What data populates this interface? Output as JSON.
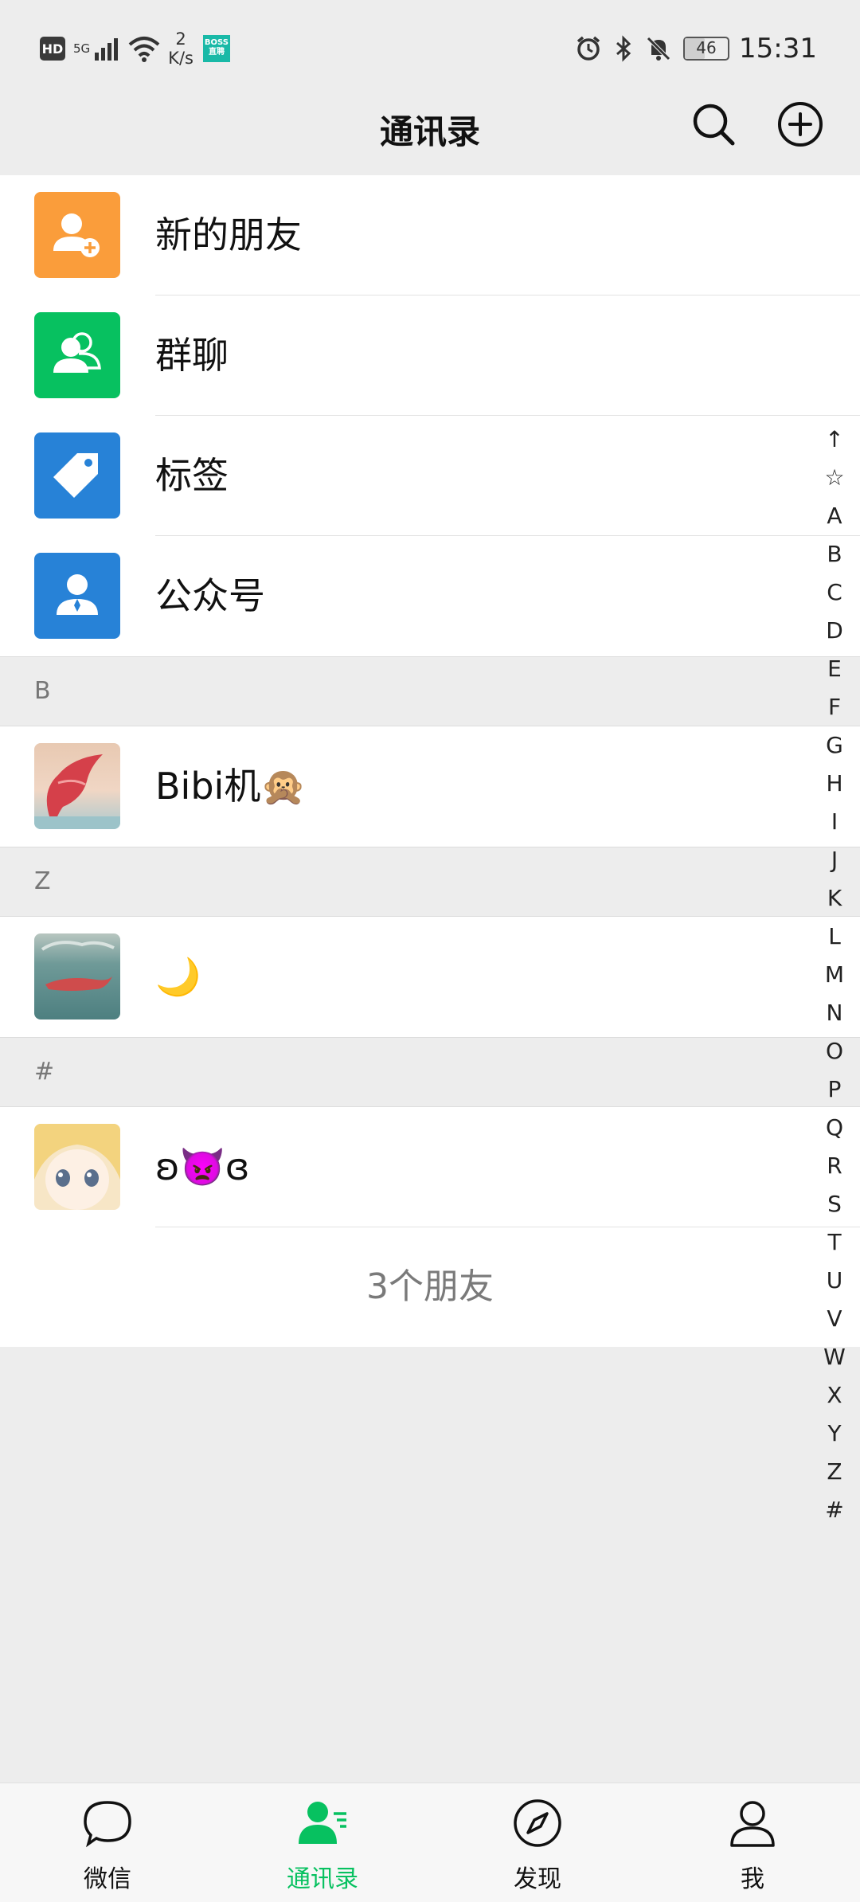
{
  "status_bar": {
    "hd": "HD",
    "network": "5G",
    "speed_value": "2",
    "speed_unit": "K/s",
    "boss_label_1": "BOSS",
    "boss_label_2": "直聘",
    "battery": "46",
    "time": "15:31"
  },
  "header": {
    "title": "通讯录"
  },
  "top_entries": [
    {
      "label": "新的朋友",
      "color": "#fa9d3b"
    },
    {
      "label": "群聊",
      "color": "#07c160"
    },
    {
      "label": "标签",
      "color": "#2782d7"
    },
    {
      "label": "公众号",
      "color": "#2782d7"
    }
  ],
  "sections": [
    {
      "letter": "B",
      "contact": "Bibi机🙊"
    },
    {
      "letter": "Z",
      "contact": "🌙"
    },
    {
      "letter": "#",
      "contact": "ʚ👿ɞ"
    }
  ],
  "footer": {
    "count": "3个朋友"
  },
  "index_letters": [
    "↑",
    "☆",
    "A",
    "B",
    "C",
    "D",
    "E",
    "F",
    "G",
    "H",
    "I",
    "J",
    "K",
    "L",
    "M",
    "N",
    "O",
    "P",
    "Q",
    "R",
    "S",
    "T",
    "U",
    "V",
    "W",
    "X",
    "Y",
    "Z",
    "#"
  ],
  "tabs": [
    {
      "label": "微信",
      "icon": "chat-icon"
    },
    {
      "label": "通讯录",
      "icon": "contacts-icon",
      "active": true
    },
    {
      "label": "发现",
      "icon": "compass-icon"
    },
    {
      "label": "我",
      "icon": "profile-icon"
    }
  ],
  "colors": {
    "accent": "#07c160"
  }
}
